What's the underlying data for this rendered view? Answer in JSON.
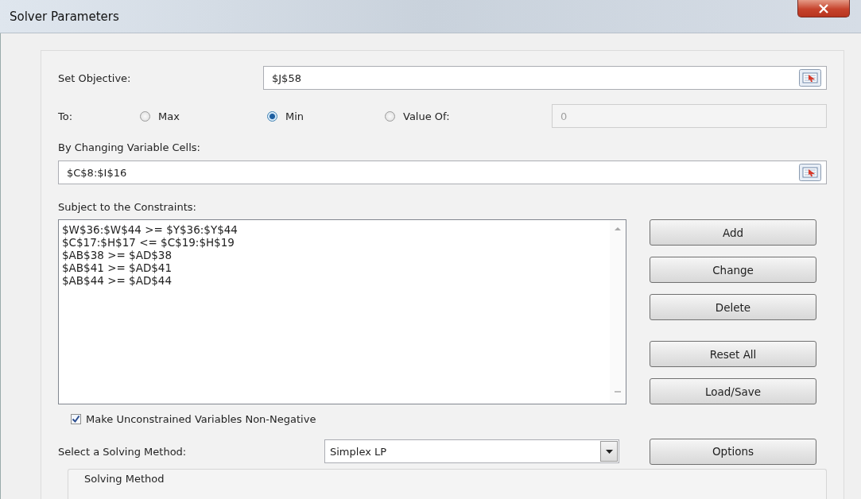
{
  "window": {
    "title": "Solver Parameters"
  },
  "objective": {
    "label": "Set Objective:",
    "value": "$J$58"
  },
  "to": {
    "label": "To:",
    "options": [
      {
        "label": "Max",
        "selected": false
      },
      {
        "label": "Min",
        "selected": true
      },
      {
        "label": "Value Of:",
        "selected": false
      }
    ],
    "value_field": {
      "value": "0",
      "disabled": true
    }
  },
  "changing": {
    "label": "By Changing Variable Cells:",
    "value": "$C$8:$I$16"
  },
  "constraints": {
    "label": "Subject to the Constraints:",
    "items": [
      "$W$36:$W$44 >= $Y$36:$Y$44",
      "$C$17:$H$17 <= $C$19:$H$19",
      "$AB$38 >= $AD$38",
      "$AB$41 >= $AD$41",
      "$AB$44 >= $AD$44"
    ]
  },
  "side_buttons": [
    [
      "Add",
      "Change",
      "Delete"
    ],
    [
      "Reset All",
      "Load/Save"
    ]
  ],
  "non_negative": {
    "label": "Make Unconstrained Variables Non-Negative",
    "checked": true
  },
  "method": {
    "label": "Select a Solving Method:",
    "value": "Simplex LP"
  },
  "options_button": "Options",
  "solving_method_group": {
    "title": "Solving Method"
  }
}
